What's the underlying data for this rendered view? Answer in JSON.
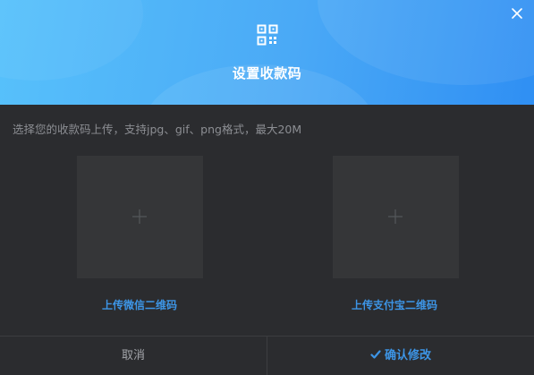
{
  "dialog": {
    "title": "设置收款码",
    "hint": "选择您的收款码上传，支持jpg、gif、png格式，最大20M",
    "icons": {
      "header": "qr-code-icon",
      "close": "close-icon",
      "upload": "plus-icon",
      "confirm": "check-icon"
    }
  },
  "uploads": [
    {
      "label": "上传微信二维码"
    },
    {
      "label": "上传支付宝二维码"
    }
  ],
  "footer": {
    "cancel_label": "取消",
    "confirm_label": "确认修改"
  },
  "colors": {
    "header_gradient_start": "#57c1fb",
    "header_gradient_end": "#2f8ff3",
    "background": "#2b2c2f",
    "accent": "#3d95e6",
    "upload_box": "#353638",
    "hint_text": "#8c8e93"
  }
}
